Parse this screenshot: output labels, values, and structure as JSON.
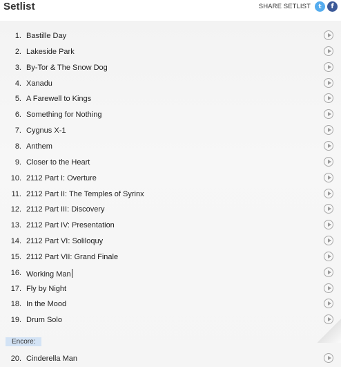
{
  "header": {
    "title": "Setlist",
    "share_label": "SHARE SETLIST",
    "twitter_glyph": "t",
    "facebook_glyph": "f",
    "twitter_color": "#55acee",
    "facebook_color": "#3b5998"
  },
  "songs": [
    {
      "num": "1.",
      "name": "Bastille Day"
    },
    {
      "num": "2.",
      "name": "Lakeside Park"
    },
    {
      "num": "3.",
      "name": "By-Tor & The Snow Dog"
    },
    {
      "num": "4.",
      "name": "Xanadu"
    },
    {
      "num": "5.",
      "name": "A Farewell to Kings"
    },
    {
      "num": "6.",
      "name": "Something for Nothing"
    },
    {
      "num": "7.",
      "name": "Cygnus X-1"
    },
    {
      "num": "8.",
      "name": "Anthem"
    },
    {
      "num": "9.",
      "name": "Closer to the Heart"
    },
    {
      "num": "10.",
      "name": "2112 Part I: Overture"
    },
    {
      "num": "11.",
      "name": "2112 Part II: The Temples of Syrinx"
    },
    {
      "num": "12.",
      "name": "2112 Part III: Discovery"
    },
    {
      "num": "13.",
      "name": "2112 Part IV: Presentation"
    },
    {
      "num": "14.",
      "name": "2112 Part VI: Soliloquy"
    },
    {
      "num": "15.",
      "name": "2112 Part VII: Grand Finale"
    },
    {
      "num": "16.",
      "name": "Working Man"
    },
    {
      "num": "17.",
      "name": "Fly by Night"
    },
    {
      "num": "18.",
      "name": "In the Mood"
    },
    {
      "num": "19.",
      "name": "Drum Solo"
    }
  ],
  "encore": {
    "label": "Encore:",
    "songs": [
      {
        "num": "20.",
        "name": "Cinderella Man"
      }
    ]
  },
  "icons": {
    "play": "play-circle-icon",
    "twitter": "twitter-icon",
    "facebook": "facebook-icon"
  }
}
